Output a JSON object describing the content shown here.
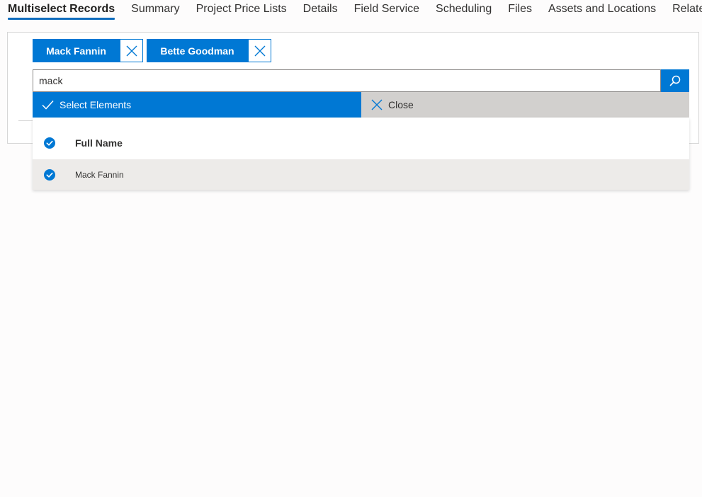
{
  "tabs": [
    {
      "label": "Multiselect Records",
      "active": true
    },
    {
      "label": "Summary"
    },
    {
      "label": "Project Price Lists"
    },
    {
      "label": "Details"
    },
    {
      "label": "Field Service"
    },
    {
      "label": "Scheduling"
    },
    {
      "label": "Files"
    },
    {
      "label": "Assets and Locations"
    },
    {
      "label": "Related"
    }
  ],
  "chips": [
    {
      "label": "Mack Fannin"
    },
    {
      "label": "Bette Goodman"
    }
  ],
  "search": {
    "value": "mack"
  },
  "actions": {
    "select_label": "Select Elements",
    "close_label": "Close"
  },
  "results": {
    "column_header": "Full Name",
    "rows": [
      {
        "full_name": "Mack Fannin",
        "selected": true
      }
    ]
  },
  "colors": {
    "accent": "#0078d4",
    "selected_row": "#edebe9",
    "close_bar": "#d2d0ce"
  }
}
